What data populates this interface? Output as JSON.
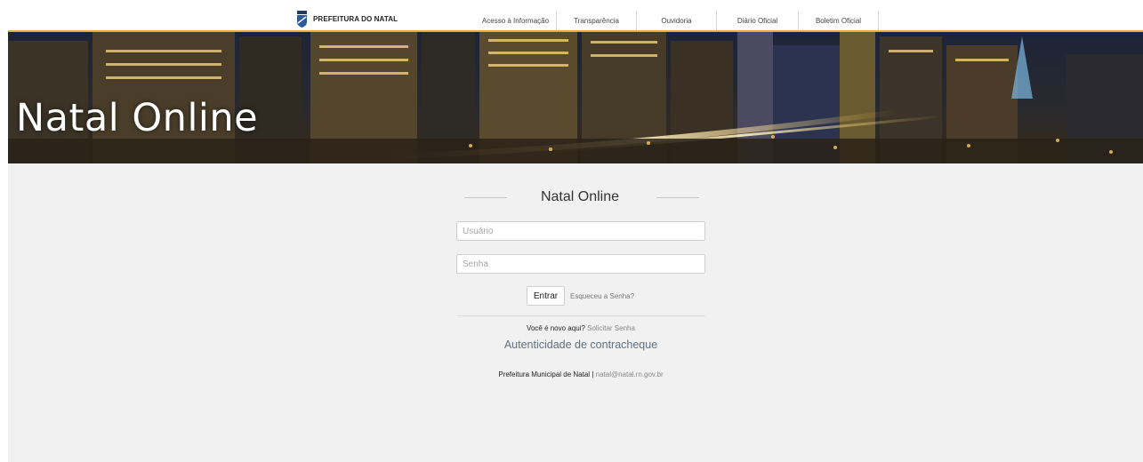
{
  "header": {
    "brand_text": "PREFEITURA DO NATAL",
    "nav": [
      {
        "label": "Acesso à Informação"
      },
      {
        "label": "Transparência"
      },
      {
        "label": "Ouvidoria"
      },
      {
        "label": "Diário Oficial"
      },
      {
        "label": "Boletim Oficial"
      }
    ]
  },
  "banner": {
    "title": "Natal Online"
  },
  "login": {
    "heading": "Natal Online",
    "username_placeholder": "Usuário",
    "password_placeholder": "Senha",
    "submit_label": "Entrar",
    "forgot_label": "Esqueceu a Senha?",
    "new_here_text": "Você é novo aqui?",
    "request_password_label": "Solicitar Senha",
    "paycheck_auth_label": "Autenticidade de contracheque"
  },
  "footer": {
    "org_text": "Prefeitura Municipal de Natal",
    "separator": "|",
    "email": "natal@natal.rn.gov.br"
  },
  "colors": {
    "accent": "#e3b23c",
    "background": "#f1f1f1"
  }
}
